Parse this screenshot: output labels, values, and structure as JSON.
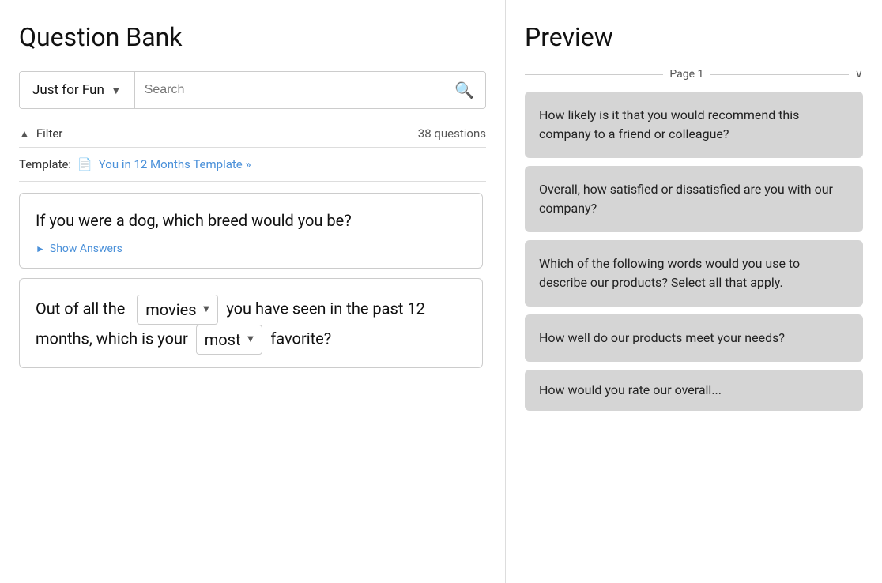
{
  "left": {
    "title": "Question Bank",
    "category": {
      "label": "Just for Fun",
      "chevron": "▼"
    },
    "search": {
      "placeholder": "Search"
    },
    "filter": {
      "label": "Filter",
      "count": "38 questions"
    },
    "template": {
      "label": "Template:",
      "link_text": "You in 12 Months Template »"
    },
    "questions": [
      {
        "id": "q1",
        "text": "If you were a dog, which breed would you be?",
        "show_answers_label": "Show Answers"
      },
      {
        "id": "q2",
        "prefix": "Out of all the",
        "dropdown1": "movies",
        "middle": "you have seen in the past 12 months, which is your",
        "dropdown2": "most",
        "suffix": "favorite?"
      }
    ]
  },
  "right": {
    "title": "Preview",
    "page": {
      "label": "Page 1",
      "chevron": "∨"
    },
    "preview_questions": [
      {
        "text": "How likely is it that you would recommend this company to a friend or colleague?"
      },
      {
        "text": "Overall, how satisfied or dissatisfied are you with our company?"
      },
      {
        "text": "Which of the following words would you use to describe our products? Select all that apply."
      },
      {
        "text": "How well do our products meet your needs?"
      },
      {
        "text": "How would you rate our overall..."
      }
    ]
  }
}
